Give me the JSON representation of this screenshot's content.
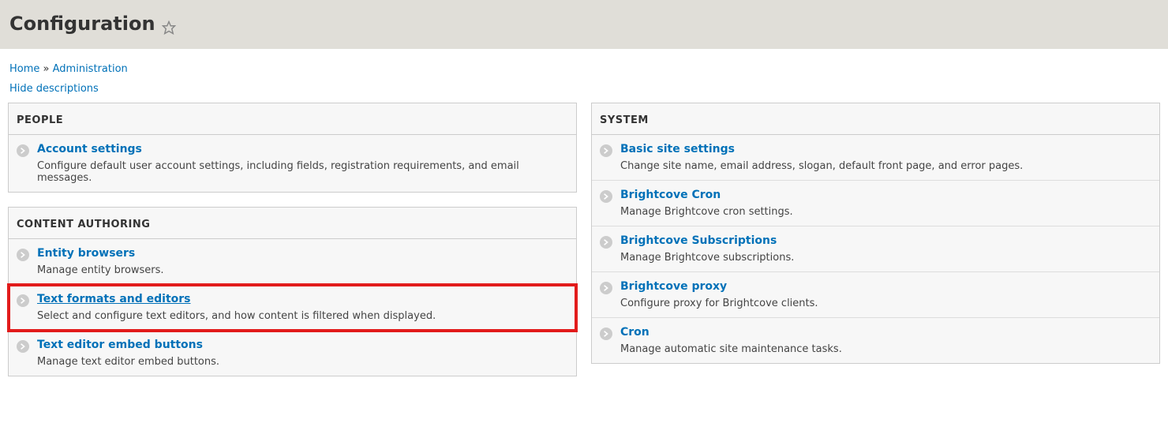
{
  "page_title": "Configuration",
  "breadcrumb": {
    "home": "Home",
    "sep": "»",
    "admin": "Administration"
  },
  "hide_descriptions": "Hide descriptions",
  "panels": {
    "people": {
      "title": "PEOPLE",
      "items": [
        {
          "label": "Account settings",
          "desc": "Configure default user account settings, including fields, registration requirements, and email messages."
        }
      ]
    },
    "content_authoring": {
      "title": "CONTENT AUTHORING",
      "items": [
        {
          "label": "Entity browsers",
          "desc": "Manage entity browsers."
        },
        {
          "label": "Text formats and editors",
          "desc": "Select and configure text editors, and how content is filtered when displayed."
        },
        {
          "label": "Text editor embed buttons",
          "desc": "Manage text editor embed buttons."
        }
      ]
    },
    "system": {
      "title": "SYSTEM",
      "items": [
        {
          "label": "Basic site settings",
          "desc": "Change site name, email address, slogan, default front page, and error pages."
        },
        {
          "label": "Brightcove Cron",
          "desc": "Manage Brightcove cron settings."
        },
        {
          "label": "Brightcove Subscriptions",
          "desc": "Manage Brightcove subscriptions."
        },
        {
          "label": "Brightcove proxy",
          "desc": "Configure proxy for Brightcove clients."
        },
        {
          "label": "Cron",
          "desc": "Manage automatic site maintenance tasks."
        }
      ]
    }
  }
}
